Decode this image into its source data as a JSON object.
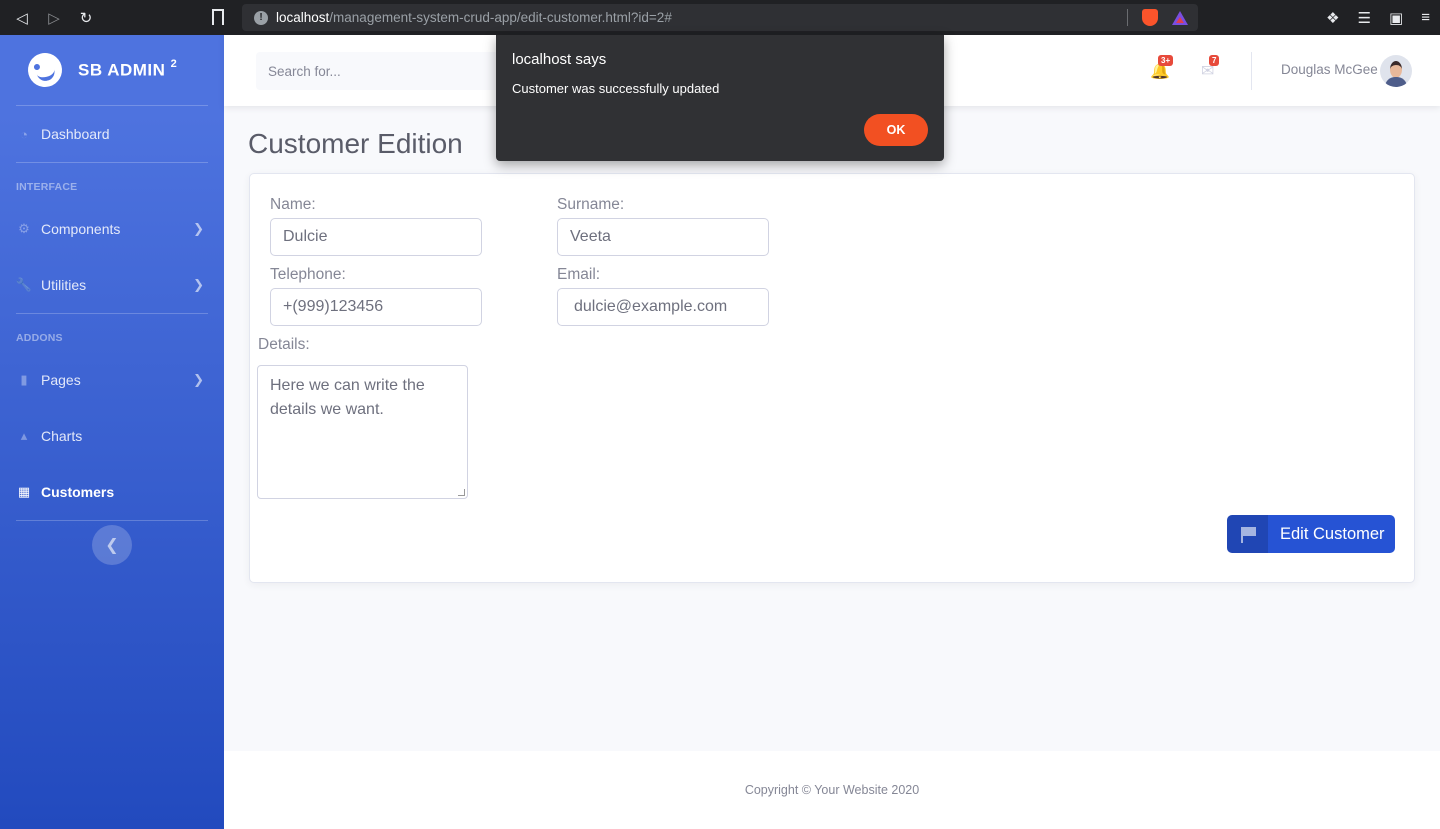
{
  "browser": {
    "url_host": "localhost",
    "url_path": "/management-system-crud-app/edit-customer.html?id=2#"
  },
  "sidebar": {
    "brand": "SB ADMIN",
    "brand_sup": "2",
    "items": [
      {
        "label": "Dashboard",
        "icon": "tachometer-icon"
      },
      {
        "label": "Components",
        "icon": "cog-icon"
      },
      {
        "label": "Utilities",
        "icon": "wrench-icon"
      },
      {
        "label": "Pages",
        "icon": "folder-icon"
      },
      {
        "label": "Charts",
        "icon": "chart-area-icon"
      },
      {
        "label": "Customers",
        "icon": "table-icon"
      }
    ],
    "headings": {
      "interface": "Interface",
      "addons": "Addons"
    }
  },
  "topbar": {
    "search_placeholder": "Search for...",
    "alerts_badge": "3+",
    "messages_badge": "7",
    "user_name": "Douglas McGee"
  },
  "page": {
    "title": "Customer Edition",
    "form": {
      "name_label": "Name:",
      "name_value": "Dulcie",
      "surname_label": "Surname:",
      "surname_value": "Veeta",
      "telephone_label": "Telephone:",
      "telephone_value": "+(999)123456",
      "email_label": "Email:",
      "email_value": "dulcie@example.com",
      "details_label": "Details:",
      "details_value": "Here we can write the details we want.",
      "submit_label": "Edit Customer"
    }
  },
  "footer": {
    "copyright": "Copyright © Your Website 2020"
  },
  "dialog": {
    "title": "localhost says",
    "message": "Customer was successfully updated",
    "ok_label": "OK"
  },
  "colors": {
    "sidebar_top": "#4e73df",
    "sidebar_bottom": "#224abe",
    "primary_button": "#2653d4",
    "dialog_ok": "#f25022",
    "badge": "#e74a3b"
  }
}
